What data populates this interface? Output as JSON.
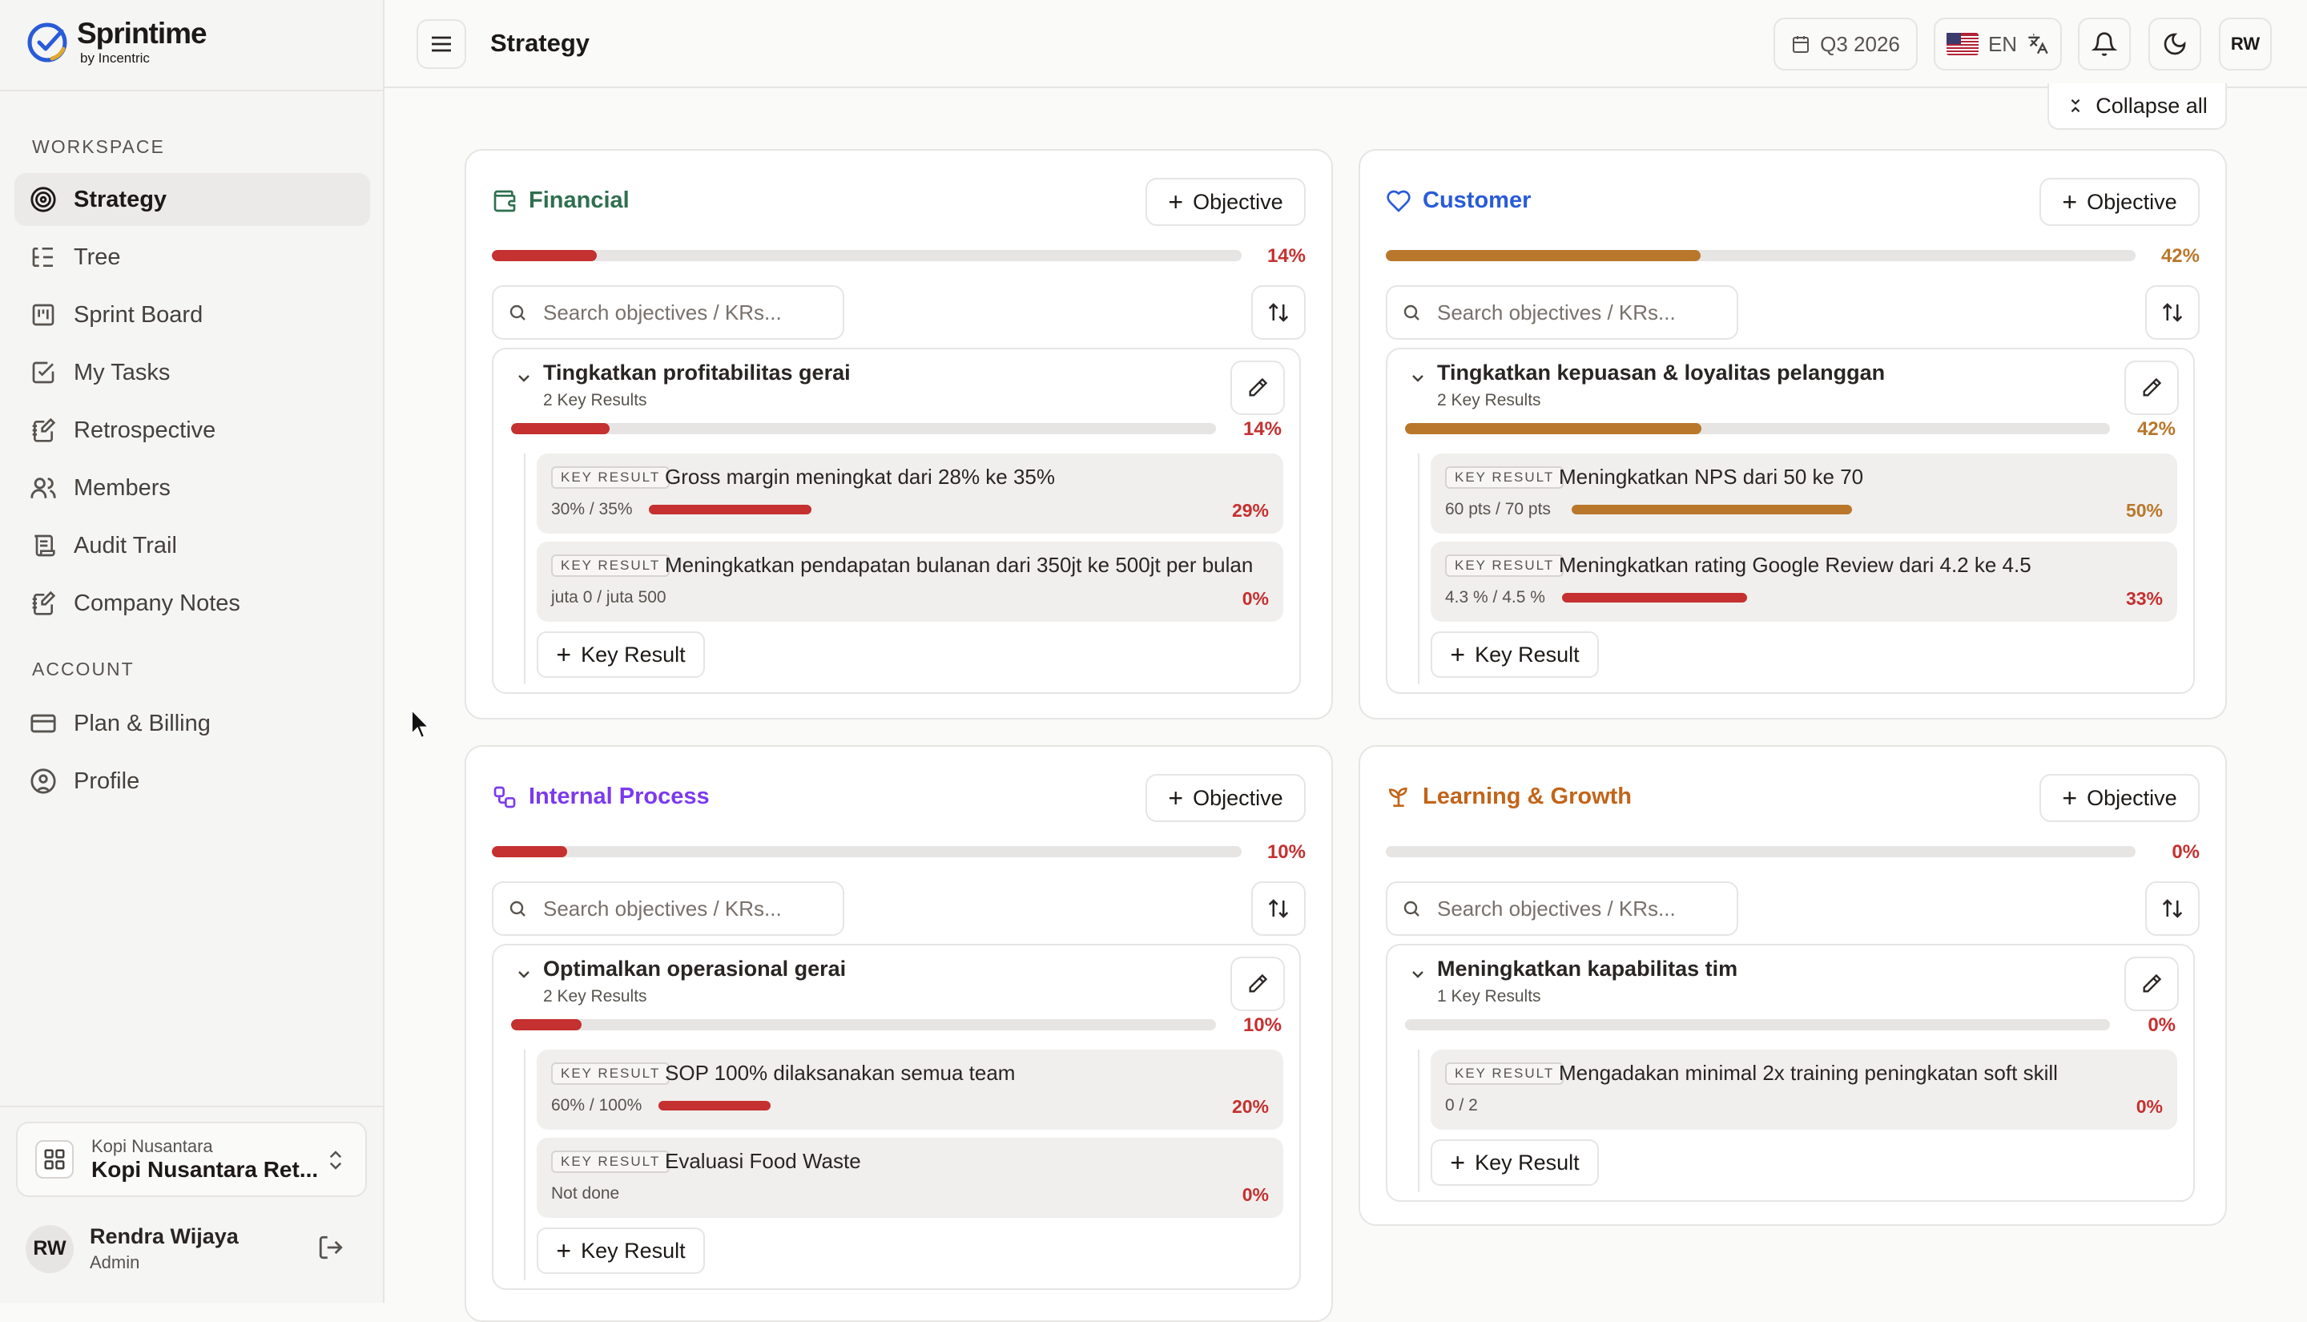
{
  "app": {
    "name": "Sprintime",
    "by": "by Incentric"
  },
  "sidebar": {
    "workspace_label": "WORKSPACE",
    "account_label": "ACCOUNT",
    "items": [
      {
        "label": "Strategy",
        "icon": "target-icon",
        "active": true
      },
      {
        "label": "Tree",
        "icon": "tree-icon"
      },
      {
        "label": "Sprint Board",
        "icon": "kanban-icon"
      },
      {
        "label": "My Tasks",
        "icon": "checkbox-icon"
      },
      {
        "label": "Retrospective",
        "icon": "notebook-pen-icon"
      },
      {
        "label": "Members",
        "icon": "users-icon"
      },
      {
        "label": "Audit Trail",
        "icon": "scroll-icon"
      },
      {
        "label": "Company Notes",
        "icon": "notebook-pen-icon"
      }
    ],
    "account_items": [
      {
        "label": "Plan & Billing",
        "icon": "credit-card-icon"
      },
      {
        "label": "Profile",
        "icon": "user-circle-icon"
      }
    ],
    "org": {
      "small": "Kopi Nusantara",
      "name": "Kopi Nusantara Ret..."
    },
    "user": {
      "initials": "RW",
      "name": "Rendra Wijaya",
      "role": "Admin"
    }
  },
  "header": {
    "title": "Strategy",
    "quarter": "Q3 2026",
    "lang": "EN",
    "avatar": "RW",
    "collapse_all": "Collapse all"
  },
  "colors": {
    "red": "#c53030",
    "orange": "#b9772b",
    "green": "#2f6f4f",
    "blue": "#2a5bd7",
    "purple": "#7c3aed",
    "amber": "#c2651a"
  },
  "perspectives": {
    "financial": {
      "title": "Financial",
      "progress": 14,
      "pct": "14%",
      "add": "Objective",
      "search_placeholder": "Search objectives / KRs...",
      "objective": {
        "title": "Tingkatkan profitabilitas gerai",
        "sub": "2 Key Results",
        "progress": 14,
        "pct": "14%",
        "krs": [
          {
            "tag": "KEY RESULT",
            "title": "Gross margin meningkat dari 28% ke 35%",
            "value": "30% / 35%",
            "progress": 29,
            "pct": "29%"
          },
          {
            "tag": "KEY RESULT",
            "title": "Meningkatkan pendapatan bulanan dari 350jt ke 500jt per bulan",
            "value": "juta 0 / juta 500",
            "progress": 0,
            "pct": "0%"
          }
        ],
        "add_kr": "Key Result"
      }
    },
    "customer": {
      "title": "Customer",
      "progress": 42,
      "pct": "42%",
      "add": "Objective",
      "search_placeholder": "Search objectives / KRs...",
      "objective": {
        "title": "Tingkatkan kepuasan & loyalitas pelanggan",
        "sub": "2 Key Results",
        "progress": 42,
        "pct": "42%",
        "krs": [
          {
            "tag": "KEY RESULT",
            "title": "Meningkatkan NPS dari 50 ke 70",
            "value": "60 pts / 70 pts",
            "progress": 50,
            "pct": "50%"
          },
          {
            "tag": "KEY RESULT",
            "title": "Meningkatkan rating Google Review dari 4.2 ke 4.5",
            "value": "4.3 % / 4.5 %",
            "progress": 33,
            "pct": "33%"
          }
        ],
        "add_kr": "Key Result"
      }
    },
    "internal": {
      "title": "Internal Process",
      "progress": 10,
      "pct": "10%",
      "add": "Objective",
      "search_placeholder": "Search objectives / KRs...",
      "objective": {
        "title": "Optimalkan operasional gerai",
        "sub": "2 Key Results",
        "progress": 10,
        "pct": "10%",
        "krs": [
          {
            "tag": "KEY RESULT",
            "title": "SOP 100% dilaksanakan semua team",
            "value": "60% / 100%",
            "progress": 20,
            "pct": "20%"
          },
          {
            "tag": "KEY RESULT",
            "title": "Evaluasi Food Waste",
            "value": "Not done",
            "progress": 0,
            "pct": "0%"
          }
        ],
        "add_kr": "Key Result"
      }
    },
    "learning": {
      "title": "Learning & Growth",
      "progress": 0,
      "pct": "0%",
      "add": "Objective",
      "search_placeholder": "Search objectives / KRs...",
      "objective": {
        "title": "Meningkatkan kapabilitas tim",
        "sub": "1 Key Results",
        "progress": 0,
        "pct": "0%",
        "krs": [
          {
            "tag": "KEY RESULT",
            "title": "Mengadakan minimal 2x training peningkatan soft skill",
            "value": "0 / 2",
            "progress": 0,
            "pct": "0%"
          }
        ],
        "add_kr": "Key Result"
      }
    }
  }
}
